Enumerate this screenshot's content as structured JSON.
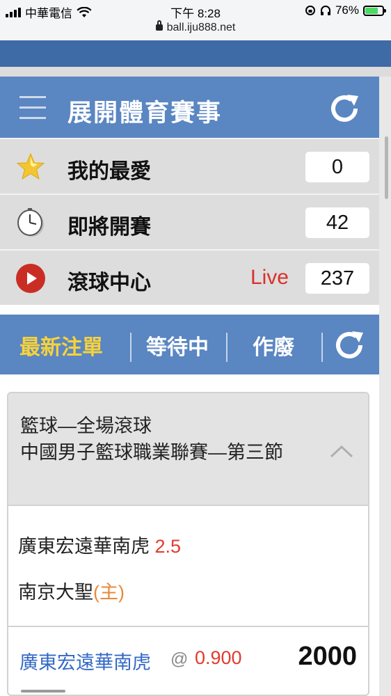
{
  "status_bar": {
    "carrier": "中華電信",
    "time": "下午 8:28",
    "url": "ball.iju888.net",
    "battery": "76%",
    "battery_level": 0.76
  },
  "header": {
    "title": "展開體育賽事",
    "menu_icon": "hamburger-menu-icon",
    "refresh_icon": "refresh-icon"
  },
  "menu": [
    {
      "label": "我的最愛",
      "count": "0",
      "icon": "star-icon"
    },
    {
      "label": "即將開賽",
      "count": "42",
      "icon": "clock-icon"
    },
    {
      "label": "滾球中心",
      "count": "237",
      "icon": "play-icon",
      "badge": "Live"
    }
  ],
  "tabs": [
    {
      "label": "最新注單",
      "active": true
    },
    {
      "label": "等待中",
      "active": false
    },
    {
      "label": "作廢",
      "active": false
    }
  ],
  "bet_card": {
    "sport_line": "籃球—全場滾球",
    "league": "中國男子籃球職業聯賽—第三節",
    "team1": "廣東宏遠華南虎",
    "handicap": "2.5",
    "team2": "南京大聖",
    "home_tag": "(主)",
    "pick": "廣東宏遠華南虎",
    "at": "@",
    "odds": "0.900",
    "stake": "2000"
  },
  "colors": {
    "header_blue": "#5a86c2",
    "active_tab": "#f7d23b",
    "live_red": "#d9312a",
    "odds_red": "#e13b2f",
    "pick_blue": "#3368c6",
    "home_orange": "#e8893a"
  }
}
